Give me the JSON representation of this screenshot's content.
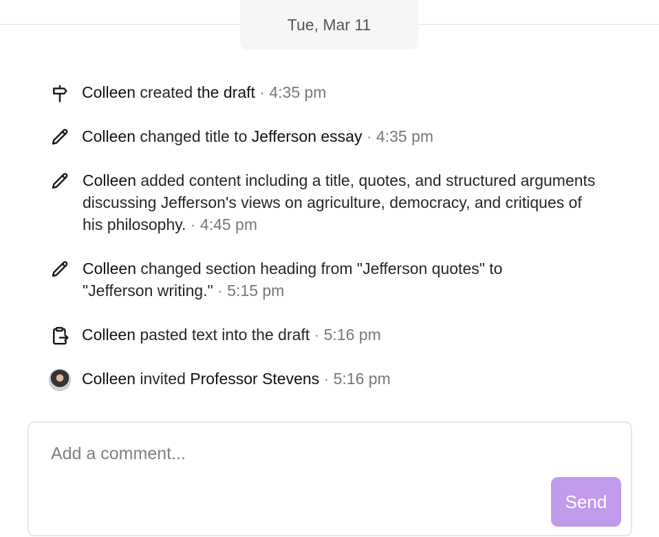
{
  "date_separator": {
    "label": "Tue, Mar 11"
  },
  "activities": [
    {
      "icon": "signpost-icon",
      "actor": "Colleen",
      "segments": [
        " created ",
        "the draft"
      ],
      "separator": " · ",
      "time": "4:35 pm"
    },
    {
      "icon": "pencil-icon",
      "actor": "Colleen",
      "segments": [
        " changed title to ",
        "Jefferson essay"
      ],
      "separator": " · ",
      "time": "4:35 pm"
    },
    {
      "icon": "pencil-icon",
      "actor": "Colleen",
      "segments": [
        " added content including a title, quotes, and structured arguments discussing Jefferson's views on agriculture, democracy, and critiques of his philosophy."
      ],
      "separator": " · ",
      "time": "4:45 pm"
    },
    {
      "icon": "pencil-icon",
      "actor": "Colleen",
      "segments": [
        " changed section heading from \"Jefferson quotes\" to \"Jefferson writing.\""
      ],
      "separator": " · ",
      "time": "5:15 pm"
    },
    {
      "icon": "clipboard-paste-icon",
      "actor": "Colleen",
      "segments": [
        " pasted text into the draft"
      ],
      "separator": " · ",
      "time": "5:16 pm"
    },
    {
      "icon": "avatar",
      "actor": "Colleen",
      "segments": [
        " invited ",
        "Professor Stevens"
      ],
      "separator": " · ",
      "time": "5:16 pm"
    }
  ],
  "comment": {
    "placeholder": "Add a comment...",
    "value": "",
    "send_label": "Send",
    "send_color": "#c09aeb"
  }
}
